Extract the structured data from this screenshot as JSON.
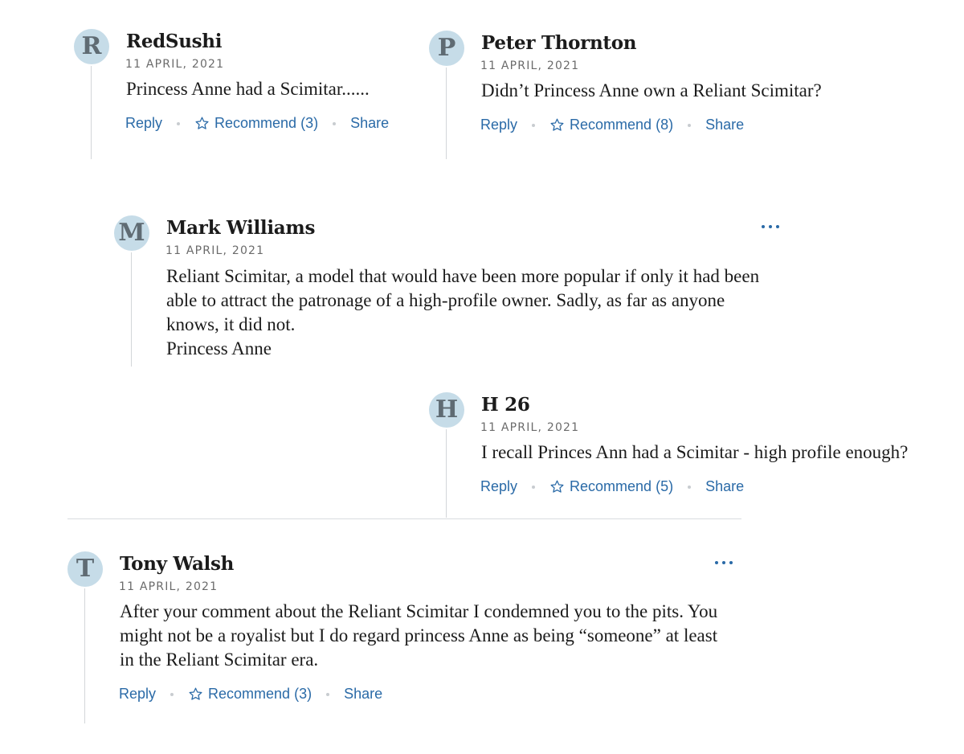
{
  "comments": [
    {
      "initial": "R",
      "author": "RedSushi",
      "date": "11 APRIL, 2021",
      "body": [
        "Princess Anne had a Scimitar......"
      ],
      "reply_label": "Reply",
      "recommend_label": "Recommend (3)",
      "share_label": "Share"
    },
    {
      "initial": "P",
      "author": "Peter Thornton",
      "date": "11 APRIL, 2021",
      "body": [
        "Didn’t Princess Anne own a Reliant Scimitar?"
      ],
      "reply_label": "Reply",
      "recommend_label": "Recommend (8)",
      "share_label": "Share"
    },
    {
      "initial": "M",
      "author": "Mark Williams",
      "date": "11 APRIL, 2021",
      "body": [
        "Reliant Scimitar, a model that would have been more popular if only it had been",
        "able to attract the patronage of a high-profile owner. Sadly, as far as anyone",
        "knows, it did not.",
        "Princess Anne"
      ]
    },
    {
      "initial": "H",
      "author": "H 26",
      "date": "11 APRIL, 2021",
      "body": [
        "I recall Princes Ann had a Scimitar - high profile enough?"
      ],
      "reply_label": "Reply",
      "recommend_label": "Recommend (5)",
      "share_label": "Share"
    },
    {
      "initial": "T",
      "author": "Tony Walsh",
      "date": "11 APRIL, 2021",
      "body": [
        "After your comment about the Reliant Scimitar I condemned you to the pits. You",
        "might not be a royalist but I do regard princess Anne as being “someone” at least",
        "in the Reliant Scimitar era."
      ],
      "reply_label": "Reply",
      "recommend_label": "Recommend (3)",
      "share_label": "Share"
    }
  ],
  "icons": {
    "recommend": "star-outline-icon",
    "more": "more-options-icon"
  },
  "colors": {
    "link": "#2a6aa7",
    "avatar_bg": "#c6dce8",
    "avatar_text": "#5f6b73",
    "text": "#1b1b1b",
    "meta": "#6b6b6b"
  }
}
